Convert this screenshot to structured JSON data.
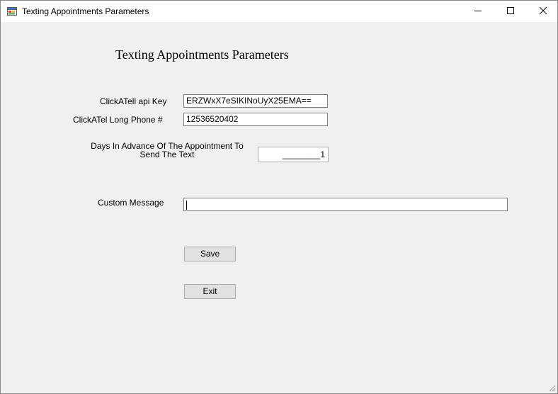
{
  "window": {
    "title": "Texting Appointments Parameters",
    "controls": [
      "minimize-icon",
      "maximize-icon",
      "close-icon"
    ]
  },
  "form": {
    "heading": "Texting Appointments Parameters",
    "api_key_label": "ClickATell api Key",
    "api_key_value": "ERZWxX7eSIKINoUyX25EMA==",
    "phone_label": "ClickATel Long Phone #",
    "phone_value": "12536520402",
    "days_label": "Days In Advance Of The Appointment To Send The Text",
    "days_value": "________1",
    "message_label": "Custom Message",
    "message_value": ""
  },
  "buttons": {
    "save_label": "Save",
    "exit_label": "Exit"
  }
}
